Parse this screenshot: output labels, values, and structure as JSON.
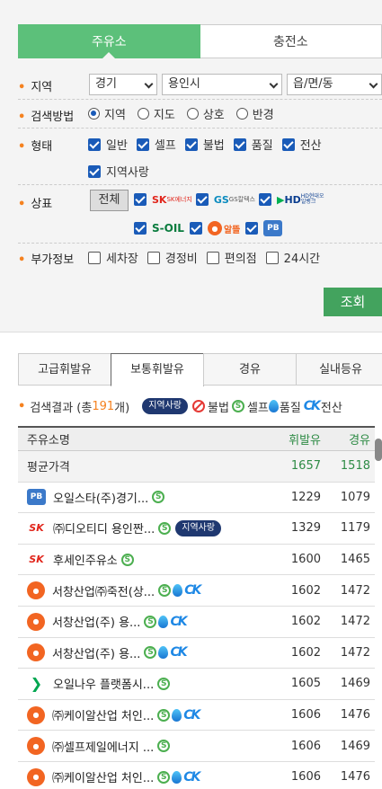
{
  "top_tabs": [
    "주유소",
    "충전소"
  ],
  "region": {
    "label": "지역",
    "province": "경기",
    "city": "용인시",
    "town": "읍/면/동"
  },
  "method": {
    "label": "검색방법",
    "options": [
      "지역",
      "지도",
      "상호",
      "반경"
    ]
  },
  "type": {
    "label": "형태",
    "options": [
      "일반",
      "셀프",
      "불법",
      "품질",
      "전산",
      "지역사랑"
    ]
  },
  "brand": {
    "label": "상표",
    "all": "전체",
    "brands": [
      "SK에너지",
      "GS칼텍스",
      "HD현대오일뱅크",
      "S-OIL",
      "알뜰",
      "PB"
    ]
  },
  "extra": {
    "label": "부가정보",
    "options": [
      "세차장",
      "경정비",
      "편의점",
      "24시간"
    ]
  },
  "search_button": "조회",
  "fuel_tabs": [
    "고급휘발유",
    "보통휘발유",
    "경유",
    "실내등유"
  ],
  "legend": {
    "prefix": "검색결과 (총 ",
    "count": "191",
    "suffix": "개)",
    "regional": "지역사랑",
    "illegal": "불법",
    "self": "셀프",
    "quality": "품질",
    "computer": "전산"
  },
  "table": {
    "headers": {
      "name": "주유소명",
      "gasoline": "휘발유",
      "diesel": "경유"
    },
    "average": {
      "label": "평균가격",
      "gasoline": "1657",
      "diesel": "1518"
    },
    "rows": [
      {
        "name": "오일스타(주)경기...",
        "gasoline": "1229",
        "diesel": "1079"
      },
      {
        "name": "㈜디오티디 용인짠...",
        "regional": "지역사랑",
        "gasoline": "1329",
        "diesel": "1179"
      },
      {
        "name": "후세인주유소",
        "gasoline": "1600",
        "diesel": "1465"
      },
      {
        "name": "서창산업㈜죽전(상...",
        "gasoline": "1602",
        "diesel": "1472"
      },
      {
        "name": "서창산업(주) 용...",
        "gasoline": "1602",
        "diesel": "1472"
      },
      {
        "name": "서창산업(주) 용...",
        "gasoline": "1602",
        "diesel": "1472"
      },
      {
        "name": "오일나우 플랫폼시...",
        "gasoline": "1605",
        "diesel": "1469"
      },
      {
        "name": "㈜케이알산업 처인...",
        "gasoline": "1606",
        "diesel": "1476"
      },
      {
        "name": "㈜셀프제일에너지 ...",
        "gasoline": "1606",
        "diesel": "1469"
      },
      {
        "name": "㈜케이알산업 처인...",
        "gasoline": "1606",
        "diesel": "1476"
      }
    ]
  }
}
